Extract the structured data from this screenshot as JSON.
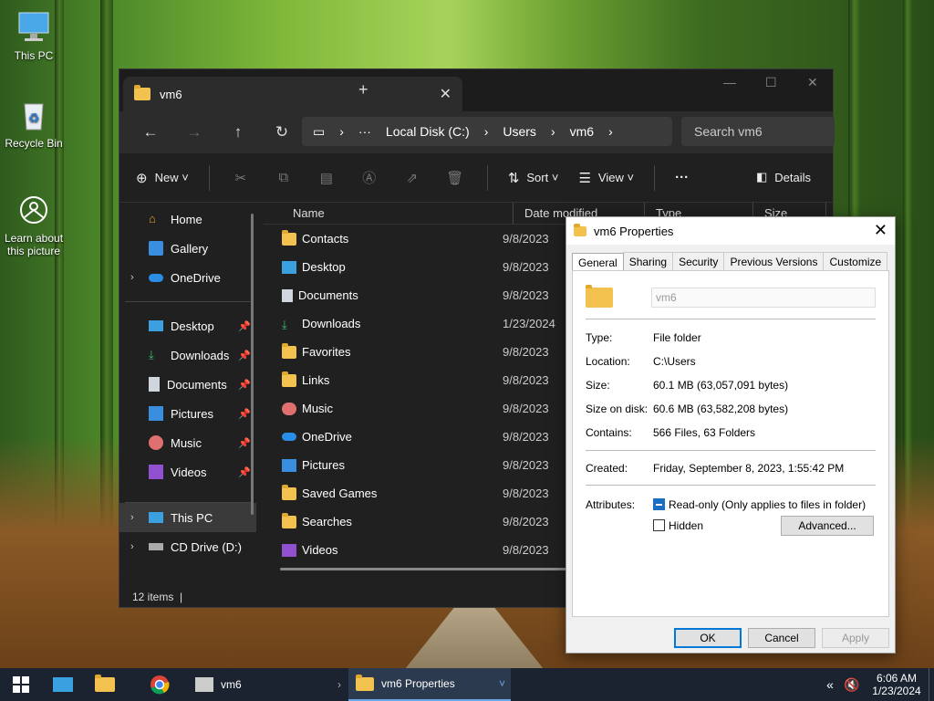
{
  "desktop": {
    "icons": [
      {
        "label": "This PC"
      },
      {
        "label": "Recycle Bin"
      },
      {
        "label": "Learn about this picture"
      }
    ]
  },
  "explorer": {
    "tab_title": "vm6",
    "breadcrumb": [
      "Local Disk (C:)",
      "Users",
      "vm6"
    ],
    "search_placeholder": "Search vm6",
    "commands": {
      "new": "New",
      "sort": "Sort",
      "view": "View",
      "details": "Details"
    },
    "sidebar": {
      "top": [
        {
          "label": "Home",
          "icon": "home-icon"
        },
        {
          "label": "Gallery",
          "icon": "gallery-icon"
        },
        {
          "label": "OneDrive",
          "icon": "cloud-icon"
        }
      ],
      "pinned": [
        {
          "label": "Desktop",
          "icon": "desktop-icon"
        },
        {
          "label": "Downloads",
          "icon": "download-icon"
        },
        {
          "label": "Documents",
          "icon": "document-icon"
        },
        {
          "label": "Pictures",
          "icon": "pictures-icon"
        },
        {
          "label": "Music",
          "icon": "music-icon"
        },
        {
          "label": "Videos",
          "icon": "videos-icon"
        }
      ],
      "drives": [
        {
          "label": "This PC",
          "icon": "pc-icon"
        },
        {
          "label": "CD Drive (D:)",
          "icon": "cd-drive-icon"
        }
      ]
    },
    "columns": [
      "Name",
      "Date modified",
      "Type",
      "Size"
    ],
    "files": [
      {
        "name": "Contacts",
        "date": "9/8/2023"
      },
      {
        "name": "Desktop",
        "date": "9/8/2023"
      },
      {
        "name": "Documents",
        "date": "9/8/2023"
      },
      {
        "name": "Downloads",
        "date": "1/23/2024"
      },
      {
        "name": "Favorites",
        "date": "9/8/2023"
      },
      {
        "name": "Links",
        "date": "9/8/2023"
      },
      {
        "name": "Music",
        "date": "9/8/2023"
      },
      {
        "name": "OneDrive",
        "date": "9/8/2023"
      },
      {
        "name": "Pictures",
        "date": "9/8/2023"
      },
      {
        "name": "Saved Games",
        "date": "9/8/2023"
      },
      {
        "name": "Searches",
        "date": "9/8/2023"
      },
      {
        "name": "Videos",
        "date": "9/8/2023"
      }
    ],
    "status": "12 items"
  },
  "properties": {
    "title": "vm6 Properties",
    "tabs": [
      "General",
      "Sharing",
      "Security",
      "Previous Versions",
      "Customize"
    ],
    "name_value": "vm6",
    "rows": {
      "type": {
        "k": "Type:",
        "v": "File folder"
      },
      "location": {
        "k": "Location:",
        "v": "C:\\Users"
      },
      "size": {
        "k": "Size:",
        "v": "60.1 MB (63,057,091 bytes)"
      },
      "size_on_disk": {
        "k": "Size on disk:",
        "v": "60.6 MB (63,582,208 bytes)"
      },
      "contains": {
        "k": "Contains:",
        "v": "566 Files, 63 Folders"
      },
      "created": {
        "k": "Created:",
        "v": "Friday, September 8, 2023, 1:55:42 PM"
      }
    },
    "attributes_label": "Attributes:",
    "readonly_label": "Read-only (Only applies to files in folder)",
    "hidden_label": "Hidden",
    "advanced_label": "Advanced...",
    "ok": "OK",
    "cancel": "Cancel",
    "apply": "Apply"
  },
  "taskbar": {
    "task1": "vm6",
    "task2": "vm6 Properties",
    "time": "6:06 AM",
    "date": "1/23/2024"
  }
}
